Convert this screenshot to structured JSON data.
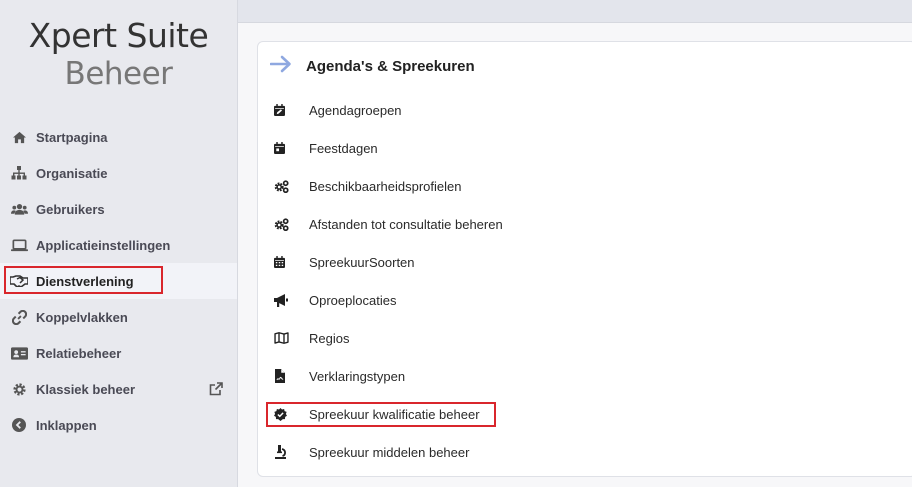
{
  "brand": {
    "line1": "Xpert Suite",
    "line2": "Beheer"
  },
  "sidebar": {
    "items": [
      {
        "label": "Startpagina",
        "icon": "home-icon"
      },
      {
        "label": "Organisatie",
        "icon": "sitemap-icon"
      },
      {
        "label": "Gebruikers",
        "icon": "users-icon"
      },
      {
        "label": "Applicatieinstellingen",
        "icon": "laptop-icon"
      },
      {
        "label": "Dienstverlening",
        "icon": "handshake-icon",
        "active": true
      },
      {
        "label": "Koppelvlakken",
        "icon": "link-icon"
      },
      {
        "label": "Relatiebeheer",
        "icon": "id-card-icon"
      },
      {
        "label": "Klassiek beheer",
        "icon": "gear-icon",
        "external": "external-link-icon"
      },
      {
        "label": "Inklappen",
        "icon": "chevron-left-circle-icon"
      }
    ]
  },
  "card": {
    "title": "Agenda's & Spreekuren",
    "header_icon": "arrow-right-icon",
    "items": [
      {
        "label": "Agendagroepen",
        "icon": "calendar-edit-icon"
      },
      {
        "label": "Feestdagen",
        "icon": "calendar-day-icon"
      },
      {
        "label": "Beschikbaarheidsprofielen",
        "icon": "gears-icon"
      },
      {
        "label": "Afstanden tot consultatie beheren",
        "icon": "gears-icon"
      },
      {
        "label": "SpreekuurSoorten",
        "icon": "calendar-grid-icon"
      },
      {
        "label": "Oproeplocaties",
        "icon": "megaphone-icon"
      },
      {
        "label": "Regios",
        "icon": "map-icon"
      },
      {
        "label": "Verklaringstypen",
        "icon": "file-signature-icon"
      },
      {
        "label": "Spreekuur kwalificatie beheer",
        "icon": "badge-check-icon"
      },
      {
        "label": "Spreekuur middelen beheer",
        "icon": "microscope-icon"
      }
    ]
  },
  "colors": {
    "highlight": "#d9262c",
    "accent_arrow": "#8fa8e0"
  }
}
